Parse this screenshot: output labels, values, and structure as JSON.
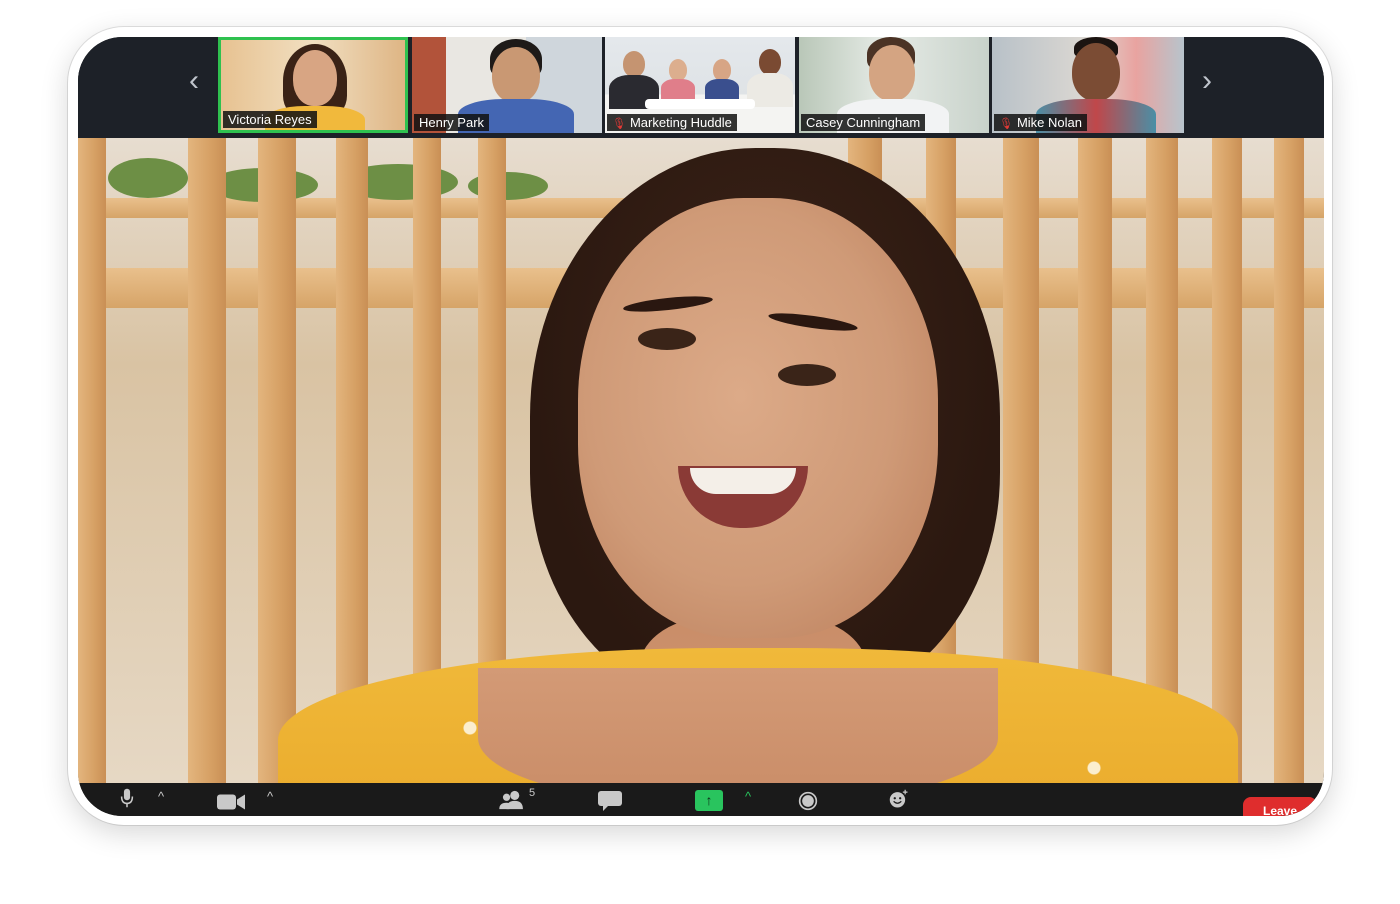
{
  "participants": [
    {
      "name": "Victoria Reyes",
      "muted": false,
      "active": true
    },
    {
      "name": "Henry Park",
      "muted": false,
      "active": false
    },
    {
      "name": "Marketing Huddle",
      "muted": true,
      "active": false
    },
    {
      "name": "Casey Cunningham",
      "muted": false,
      "active": false
    },
    {
      "name": "Mike Nolan",
      "muted": true,
      "active": false
    }
  ],
  "nav": {
    "prev_icon": "‹",
    "next_icon": "›"
  },
  "toolbar": {
    "participants_count": "5",
    "share_icon": "↑",
    "caret": "^",
    "leave_label": "Leave"
  },
  "colors": {
    "active_border": "#2fc14f",
    "share_green": "#29c45e",
    "leave_red": "#df2d2d",
    "muted_red": "#e53935"
  }
}
